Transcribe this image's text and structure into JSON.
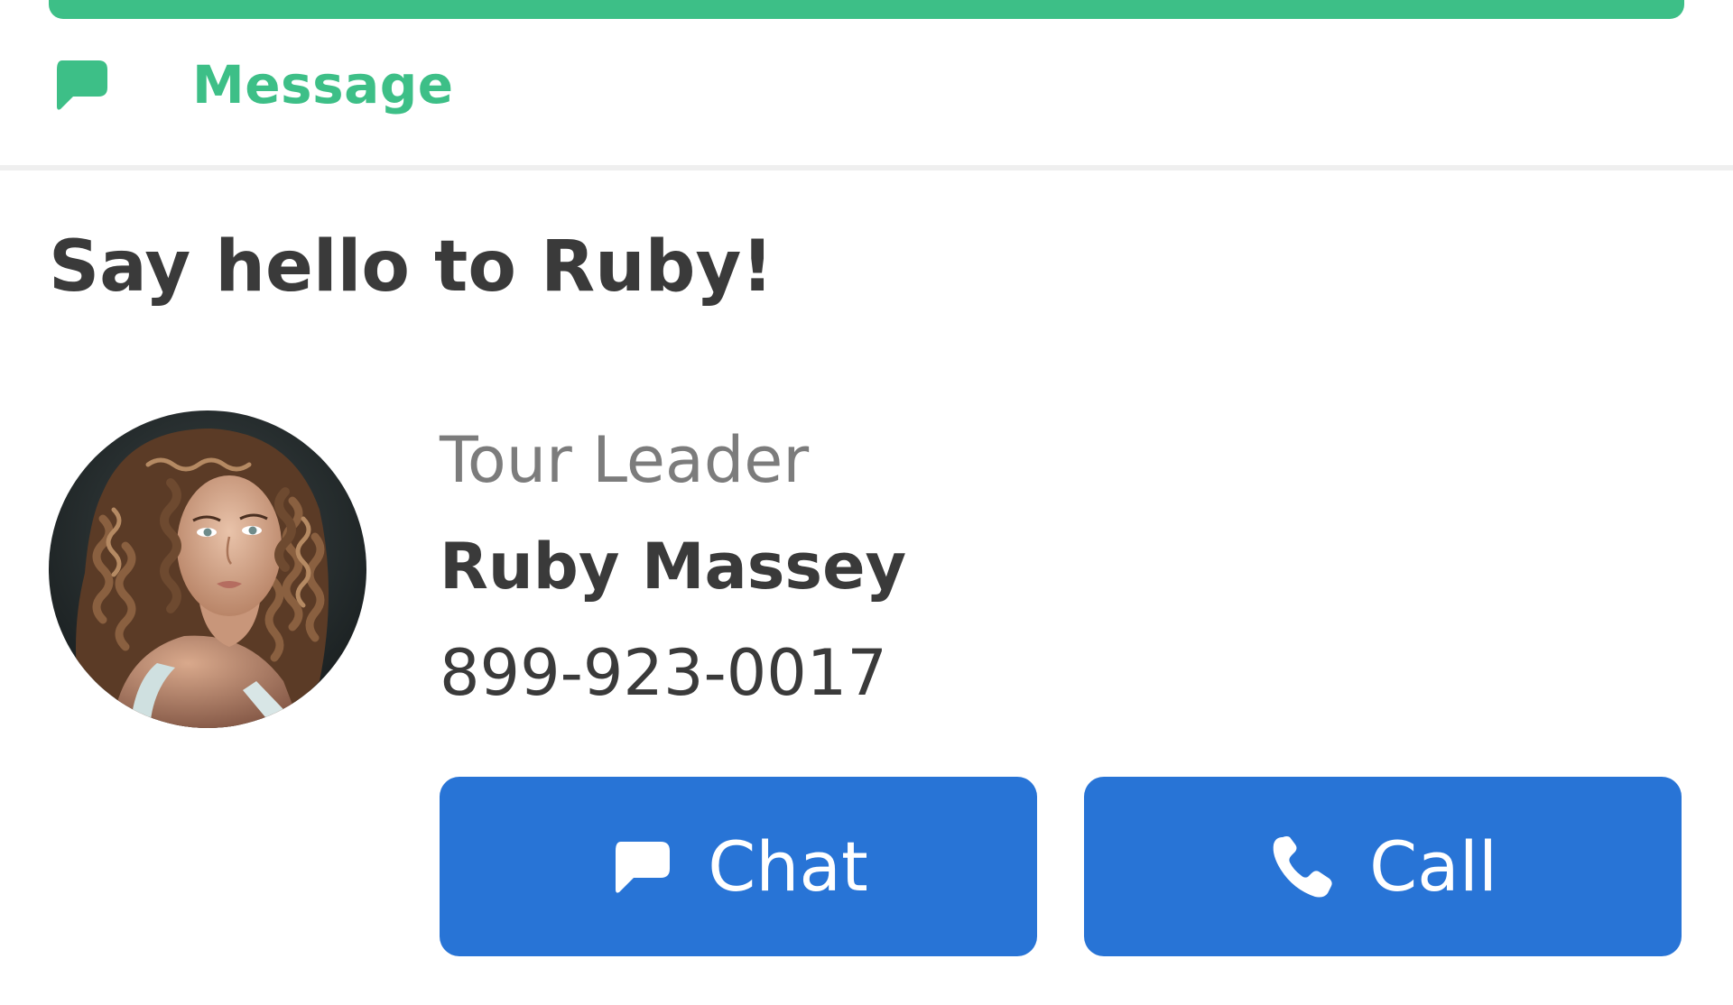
{
  "actions": {
    "message_label": "Message"
  },
  "contact": {
    "heading": "Say hello to Ruby!",
    "role": "Tour Leader",
    "name": "Ruby Massey",
    "phone": "899-923-0017",
    "avatar_alt": "Ruby Massey"
  },
  "buttons": {
    "chat_label": "Chat",
    "call_label": "Call"
  },
  "icons": {
    "message": "chat-bubble-icon",
    "chat": "chat-bubble-icon",
    "call": "phone-icon"
  },
  "colors": {
    "accent_green": "#3dbf87",
    "primary_blue": "#2874d6",
    "text_dark": "#3a3a3a",
    "text_muted": "#7c7c7c",
    "divider": "#efefef"
  }
}
